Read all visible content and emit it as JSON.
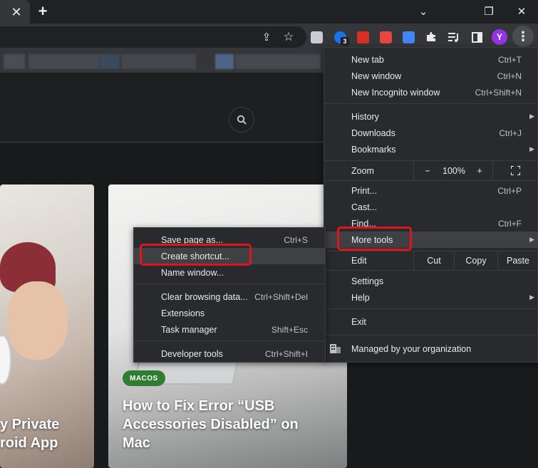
{
  "window": {
    "tab_close_glyph": "✕",
    "new_tab_glyph": "+",
    "chevron_glyph": "⌄",
    "restore_glyph": "❐",
    "close_glyph": "✕"
  },
  "toolbar": {
    "share_glyph": "⇪",
    "star_glyph": "☆",
    "extension_badge_count": "3",
    "profile_initial": "Y",
    "menu_glyph": "⋮"
  },
  "page": {
    "search_glyph": "🔍",
    "card_left_title": "y Private\nroid App",
    "card_left_title_line1": "y Private",
    "card_left_title_line2": "roid App",
    "card_right_tag": "MACOS",
    "card_right_title_line1": "How to Fix Error “USB",
    "card_right_title_line2": "Accessories Disabled” on",
    "card_right_title_line3": "Mac"
  },
  "main_menu": {
    "new_tab": {
      "label": "New tab",
      "shortcut": "Ctrl+T"
    },
    "new_window": {
      "label": "New window",
      "shortcut": "Ctrl+N"
    },
    "new_incognito": {
      "label": "New Incognito window",
      "shortcut": "Ctrl+Shift+N"
    },
    "history": {
      "label": "History"
    },
    "downloads": {
      "label": "Downloads",
      "shortcut": "Ctrl+J"
    },
    "bookmarks": {
      "label": "Bookmarks"
    },
    "zoom": {
      "label": "Zoom",
      "minus": "−",
      "value": "100%",
      "plus": "+"
    },
    "print": {
      "label": "Print...",
      "shortcut": "Ctrl+P"
    },
    "cast": {
      "label": "Cast..."
    },
    "find": {
      "label": "Find...",
      "shortcut": "Ctrl+F"
    },
    "more_tools": {
      "label": "More tools"
    },
    "edit": {
      "label": "Edit",
      "cut": "Cut",
      "copy": "Copy",
      "paste": "Paste"
    },
    "settings": {
      "label": "Settings"
    },
    "help": {
      "label": "Help"
    },
    "exit": {
      "label": "Exit"
    },
    "managed": {
      "label": "Managed by your organization"
    }
  },
  "sub_menu": {
    "save_page": {
      "label": "Save page as...",
      "shortcut": "Ctrl+S"
    },
    "create_shortcut": {
      "label": "Create shortcut..."
    },
    "name_window": {
      "label": "Name window..."
    },
    "clear_browsing": {
      "label": "Clear browsing data...",
      "shortcut": "Ctrl+Shift+Del"
    },
    "extensions": {
      "label": "Extensions"
    },
    "task_manager": {
      "label": "Task manager",
      "shortcut": "Shift+Esc"
    },
    "developer_tools": {
      "label": "Developer tools",
      "shortcut": "Ctrl+Shift+I"
    }
  },
  "colors": {
    "highlight_outline": "#e0141b",
    "menu_bg": "#292a2d",
    "menu_hover": "#3f4043",
    "profile_avatar": "#9334e6",
    "tag_green": "#2e7d32"
  }
}
